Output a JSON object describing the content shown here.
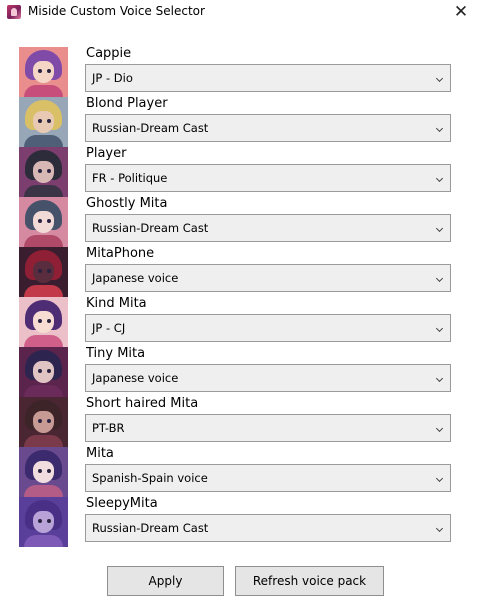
{
  "window": {
    "title": "Miside Custom Voice Selector",
    "close_glyph": "✕",
    "icon": "miside-app-icon"
  },
  "characters": [
    {
      "name": "Cappie",
      "voice": "JP - Dio",
      "avatar": {
        "bg": "#e98d8d",
        "hair": "#7f4aa8",
        "skin": "#f4d5c6",
        "body": "#c74d7a"
      }
    },
    {
      "name": "Blond Player",
      "voice": "Russian-Dream Cast",
      "avatar": {
        "bg": "#97a7b8",
        "hair": "#d9c066",
        "skin": "#e8c9b3",
        "body": "#4f5f78"
      }
    },
    {
      "name": "Player",
      "voice": "FR - Politique",
      "avatar": {
        "bg": "#7c3e6f",
        "hair": "#2c2c3a",
        "skin": "#d8b8b4",
        "body": "#3a3446"
      }
    },
    {
      "name": "Ghostly Mita",
      "voice": "Russian-Dream Cast",
      "avatar": {
        "bg": "#d58aa2",
        "hair": "#45526a",
        "skin": "#f2dad6",
        "body": "#b04a68"
      }
    },
    {
      "name": "MitaPhone",
      "voice": "Japanese voice",
      "avatar": {
        "bg": "#3a1e30",
        "hair": "#8e1f34",
        "skin": "#5a2d3e",
        "body": "#c23a4a"
      }
    },
    {
      "name": "Kind Mita",
      "voice": "JP - CJ",
      "avatar": {
        "bg": "#ecc0c8",
        "hair": "#4e2d74",
        "skin": "#f6dcd2",
        "body": "#d05f8a"
      }
    },
    {
      "name": "Tiny Mita",
      "voice": "Japanese voice",
      "avatar": {
        "bg": "#5a244c",
        "hair": "#2e2450",
        "skin": "#e0c4c4",
        "body": "#6a2a5a"
      }
    },
    {
      "name": "Short haired Mita",
      "voice": "PT-BR",
      "avatar": {
        "bg": "#4a2532",
        "hair": "#3d2428",
        "skin": "#c79a94",
        "body": "#7a3a4a"
      }
    },
    {
      "name": "Mita",
      "voice": "Spanish-Spain voice",
      "avatar": {
        "bg": "#6a4a8e",
        "hair": "#3b2a6e",
        "skin": "#f1dde0",
        "body": "#b45c88"
      }
    },
    {
      "name": "SleepyMita",
      "voice": "Russian-Dream Cast",
      "avatar": {
        "bg": "#5a3f9a",
        "hair": "#4a2f86",
        "skin": "#b8a2d8",
        "body": "#7c5ab6"
      }
    }
  ],
  "buttons": {
    "apply": "Apply",
    "refresh": "Refresh voice pack"
  }
}
